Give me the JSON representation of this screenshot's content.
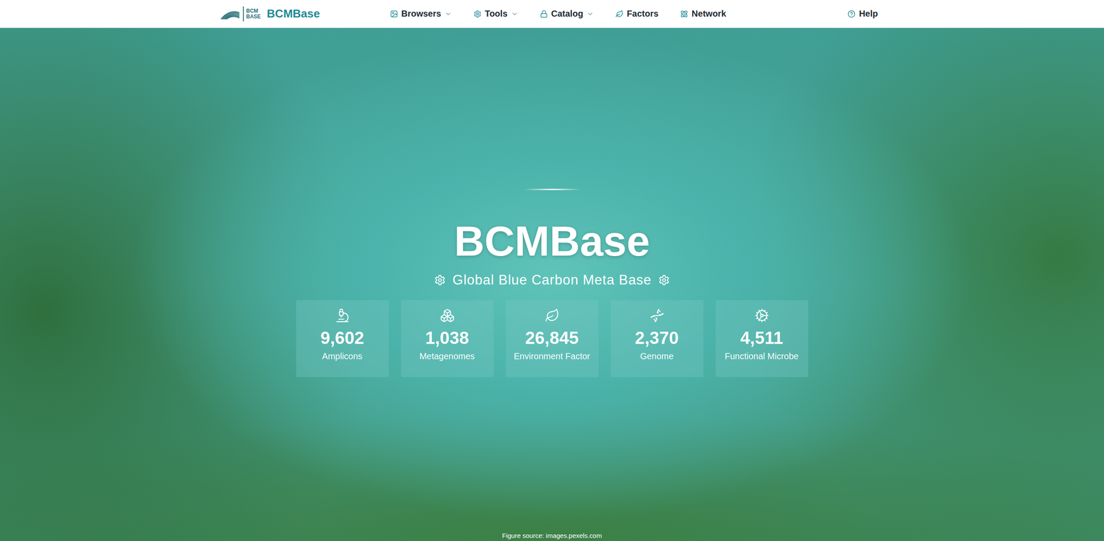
{
  "nav": {
    "logo": {
      "mark_lines": [
        "BCM",
        "BASE"
      ],
      "name": "BCMBase"
    },
    "items": [
      {
        "label": "Browsers",
        "dropdown": true
      },
      {
        "label": "Tools",
        "dropdown": true
      },
      {
        "label": "Catalog",
        "dropdown": true
      },
      {
        "label": "Factors",
        "dropdown": false
      },
      {
        "label": "Network",
        "dropdown": false
      }
    ],
    "help": "Help"
  },
  "hero": {
    "title": "BCMBase",
    "subtitle": "Global Blue Carbon Meta Base",
    "stats": [
      {
        "value": "9,602",
        "label": "Amplicons"
      },
      {
        "value": "1,038",
        "label": "Metagenomes"
      },
      {
        "value": "26,845",
        "label": "Environment Factor"
      },
      {
        "value": "2,370",
        "label": "Genome"
      },
      {
        "value": "4,511",
        "label": "Functional Microbe"
      }
    ]
  },
  "footer": "Figure source: images.pexels.com"
}
